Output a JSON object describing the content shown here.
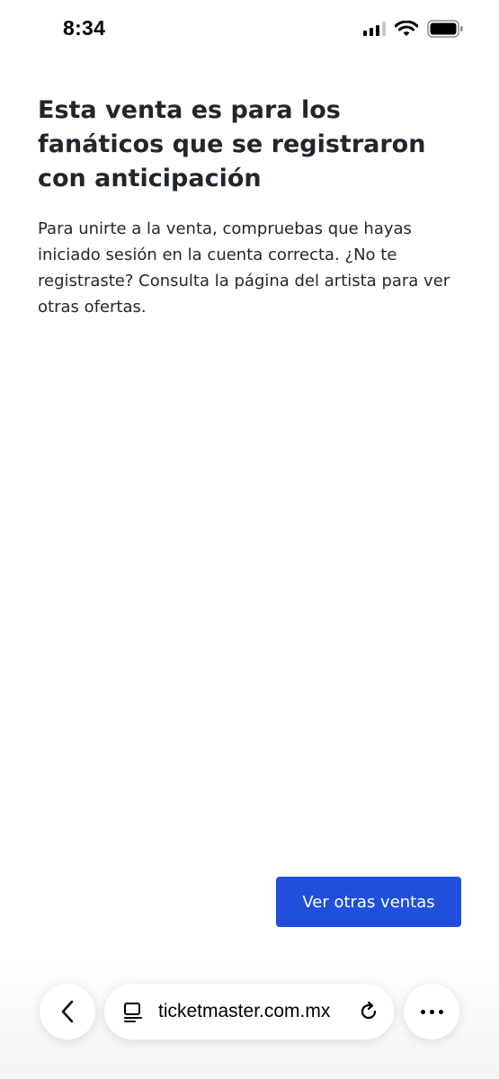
{
  "status_bar": {
    "time": "8:34",
    "icons": [
      "cellular-signal-icon",
      "wifi-icon",
      "battery-icon"
    ]
  },
  "main": {
    "title": "Esta venta es para los fanáticos que se registraron con anticipación",
    "description": "Para unirte a la venta, compruebas que hayas iniciado sesión en la cuenta correcta. ¿No te registraste? Consulta la página del artista para ver otras ofertas.",
    "primary_button_label": "Ver otras ventas"
  },
  "browser": {
    "url": "ticketmaster.com.mx",
    "icons": [
      "back-chevron-icon",
      "reader-mode-icon",
      "reload-icon",
      "more-icon"
    ]
  },
  "colors": {
    "accent": "#1f4fdc",
    "text": "#1f262d",
    "background": "#ffffff"
  }
}
